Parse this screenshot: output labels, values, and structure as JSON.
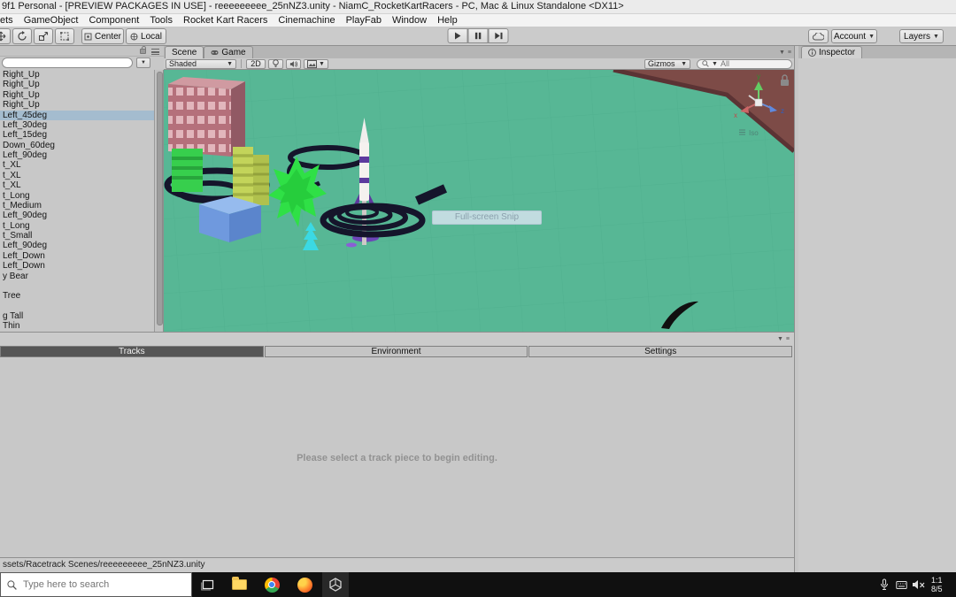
{
  "titlebar": {
    "title": "9f1 Personal - [PREVIEW PACKAGES IN USE] - reeeeeeeee_25nNZ3.unity - NiamC_RocketKartRacers - PC, Mac & Linux Standalone <DX11>"
  },
  "menubar": {
    "items": [
      "ets",
      "GameObject",
      "Component",
      "Tools",
      "Rocket Kart Racers",
      "Cinemachine",
      "PlayFab",
      "Window",
      "Help"
    ]
  },
  "toolbar": {
    "pivot": "Center",
    "space": "Local",
    "account": "Account",
    "layers": "Layers"
  },
  "hierarchy": {
    "items": [
      {
        "label": "Right_Up",
        "selected": false
      },
      {
        "label": "Right_Up",
        "selected": false
      },
      {
        "label": "Right_Up",
        "selected": false
      },
      {
        "label": "Right_Up",
        "selected": false
      },
      {
        "label": "Left_45deg",
        "selected": true
      },
      {
        "label": "Left_30deg",
        "selected": false
      },
      {
        "label": "Left_15deg",
        "selected": false
      },
      {
        "label": "Down_60deg",
        "selected": false
      },
      {
        "label": "Left_90deg",
        "selected": false
      },
      {
        "label": "t_XL",
        "selected": false
      },
      {
        "label": "t_XL",
        "selected": false
      },
      {
        "label": "t_XL",
        "selected": false
      },
      {
        "label": "t_Long",
        "selected": false
      },
      {
        "label": "t_Medium",
        "selected": false
      },
      {
        "label": "Left_90deg",
        "selected": false
      },
      {
        "label": "t_Long",
        "selected": false
      },
      {
        "label": "t_Small",
        "selected": false
      },
      {
        "label": "Left_90deg",
        "selected": false
      },
      {
        "label": "Left_Down",
        "selected": false
      },
      {
        "label": "Left_Down",
        "selected": false
      },
      {
        "label": "y Bear",
        "selected": false
      },
      {
        "label": "",
        "selected": false
      },
      {
        "label": "Tree",
        "selected": false
      },
      {
        "label": "",
        "selected": false
      },
      {
        "label": "g Tall",
        "selected": false
      },
      {
        "label": "Thin",
        "selected": false
      }
    ]
  },
  "scene": {
    "tabs": [
      "Scene",
      "Game"
    ],
    "shading_mode": "Shaded",
    "toggle_2d": "2D",
    "gizmos_label": "Gizmos",
    "search_value": "All",
    "iso_label": "Iso",
    "axis": {
      "x": "x",
      "y": "y",
      "z": "z"
    },
    "snip_overlay": "Full-screen Snip",
    "colors": {
      "ground": "#57b795",
      "terrain": "#7d4b47",
      "track": "#15152b",
      "building_pink": "#b5707b",
      "building_green": "#37cf4d",
      "building_yellow": "#c3d45a",
      "box_blue": "#6f99de",
      "bush_green": "#2fe046",
      "rocket_white": "#f5f1ef",
      "rocket_purple": "#5d3a9e"
    }
  },
  "inspector": {
    "tab": "Inspector"
  },
  "bottom_panel": {
    "tabs": [
      {
        "label": "Tracks",
        "active": true
      },
      {
        "label": "Environment",
        "active": false
      },
      {
        "label": "Settings",
        "active": false
      }
    ],
    "message": "Please select a track piece to begin editing."
  },
  "statusbar": {
    "path": "ssets/Racetrack Scenes/reeeeeeeee_25nNZ3.unity"
  },
  "taskbar": {
    "search_placeholder": "Type here to search",
    "clock_line1": "1:1",
    "clock_line2": "8/5"
  }
}
